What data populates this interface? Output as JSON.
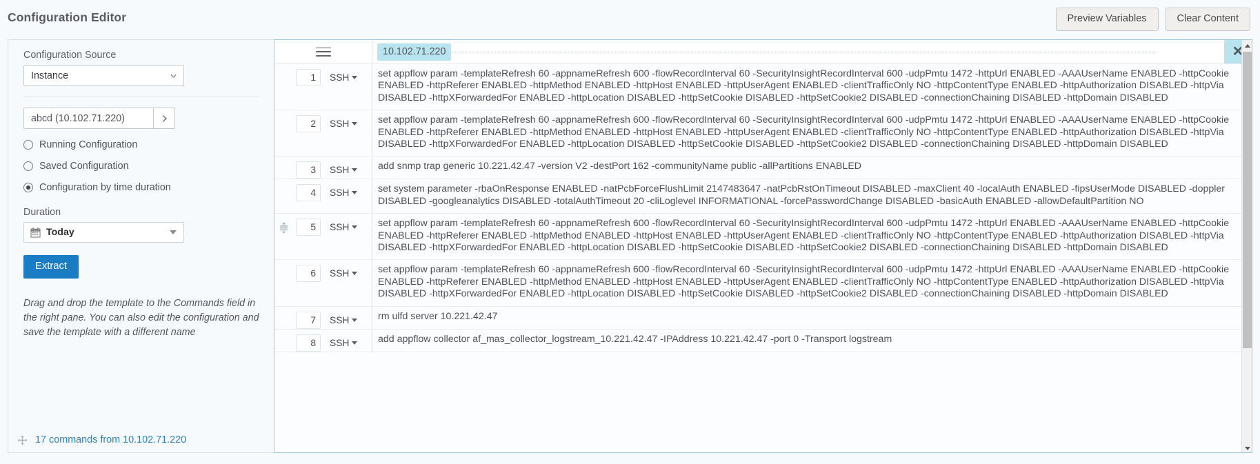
{
  "header": {
    "title": "Configuration Editor",
    "preview_variables_label": "Preview Variables",
    "clear_content_label": "Clear Content"
  },
  "left_panel": {
    "config_source_label": "Configuration Source",
    "config_source_value": "Instance",
    "instance_value": "abcd (10.102.71.220)",
    "instance_placeholder": "abcd (10.102.71.220)",
    "go_icon": "chevron-right-icon",
    "radios": [
      {
        "label": "Running Configuration",
        "checked": false
      },
      {
        "label": "Saved Configuration",
        "checked": false
      },
      {
        "label": "Configuration by time duration",
        "checked": true
      }
    ],
    "duration_label": "Duration",
    "duration_value": "Today",
    "extract_label": "Extract",
    "hint": "Drag and drop the template to the Commands field in the right pane. You can also edit the configuration and save the template with a different name",
    "commands_link": "17 commands from 10.102.71.220",
    "move_icon": "move-icon"
  },
  "right_panel": {
    "menu_icon": "hamburger-icon",
    "ip_tag": "10.102.71.220",
    "close_icon": "close-icon",
    "protocol": "SSH",
    "rows": [
      {
        "num": "1",
        "protocol": "SSH",
        "handle": false,
        "command": "set appflow param -templateRefresh 60 -appnameRefresh 600 -flowRecordInterval 60 -SecurityInsightRecordInterval 600 -udpPmtu 1472 -httpUrl ENABLED -AAAUserName ENABLED -httpCookie ENABLED -httpReferer ENABLED -httpMethod ENABLED -httpHost ENABLED -httpUserAgent ENABLED -clientTrafficOnly NO -httpContentType ENABLED -httpAuthorization DISABLED -httpVia DISABLED -httpXForwardedFor ENABLED -httpLocation DISABLED -httpSetCookie DISABLED -httpSetCookie2 DISABLED -connectionChaining DISABLED -httpDomain DISABLED"
      },
      {
        "num": "2",
        "protocol": "SSH",
        "handle": false,
        "command": "set appflow param -templateRefresh 60 -appnameRefresh 600 -flowRecordInterval 60 -SecurityInsightRecordInterval 600 -udpPmtu 1472 -httpUrl ENABLED -AAAUserName ENABLED -httpCookie ENABLED -httpReferer ENABLED -httpMethod ENABLED -httpHost ENABLED -httpUserAgent ENABLED -clientTrafficOnly NO -httpContentType ENABLED -httpAuthorization DISABLED -httpVia DISABLED -httpXForwardedFor ENABLED -httpLocation DISABLED -httpSetCookie DISABLED -httpSetCookie2 DISABLED -connectionChaining DISABLED -httpDomain DISABLED"
      },
      {
        "num": "3",
        "protocol": "SSH",
        "handle": false,
        "command": "add snmp trap generic 10.221.42.47 -version V2 -destPort 162 -communityName public -allPartitions ENABLED"
      },
      {
        "num": "4",
        "protocol": "SSH",
        "handle": false,
        "command": "set system parameter -rbaOnResponse ENABLED -natPcbForceFlushLimit 2147483647 -natPcbRstOnTimeout DISABLED -maxClient 40 -localAuth ENABLED -fipsUserMode DISABLED -doppler DISABLED -googleanalytics DISABLED -totalAuthTimeout 20 -cliLoglevel INFORMATIONAL -forcePasswordChange DISABLED -basicAuth ENABLED -allowDefaultPartition NO"
      },
      {
        "num": "5",
        "protocol": "SSH",
        "handle": true,
        "command": "set appflow param -templateRefresh 60 -appnameRefresh 600 -flowRecordInterval 60 -SecurityInsightRecordInterval 600 -udpPmtu 1472 -httpUrl ENABLED -AAAUserName ENABLED -httpCookie ENABLED -httpReferer ENABLED -httpMethod ENABLED -httpHost ENABLED -httpUserAgent ENABLED -clientTrafficOnly NO -httpContentType ENABLED -httpAuthorization DISABLED -httpVia DISABLED -httpXForwardedFor ENABLED -httpLocation DISABLED -httpSetCookie DISABLED -httpSetCookie2 DISABLED -connectionChaining DISABLED -httpDomain DISABLED"
      },
      {
        "num": "6",
        "protocol": "SSH",
        "handle": false,
        "command": "set appflow param -templateRefresh 60 -appnameRefresh 600 -flowRecordInterval 60 -SecurityInsightRecordInterval 600 -udpPmtu 1472 -httpUrl ENABLED -AAAUserName ENABLED -httpCookie ENABLED -httpReferer ENABLED -httpMethod ENABLED -httpHost ENABLED -httpUserAgent ENABLED -clientTrafficOnly NO -httpContentType ENABLED -httpAuthorization DISABLED -httpVia DISABLED -httpXForwardedFor ENABLED -httpLocation DISABLED -httpSetCookie DISABLED -httpSetCookie2 DISABLED -connectionChaining DISABLED -httpDomain DISABLED"
      },
      {
        "num": "7",
        "protocol": "SSH",
        "handle": false,
        "command": "rm ulfd server 10.221.42.47"
      },
      {
        "num": "8",
        "protocol": "SSH",
        "handle": false,
        "command": "add appflow collector af_mas_collector_logstream_10.221.42.47 -IPAddress 10.221.42.47 -port 0 -Transport logstream"
      }
    ]
  },
  "colors": {
    "accent_blue": "#1a7dc4",
    "link_blue": "#2f7fc1",
    "tag_cyan": "#b8e4ef",
    "panel_border": "#9fc9e0"
  }
}
